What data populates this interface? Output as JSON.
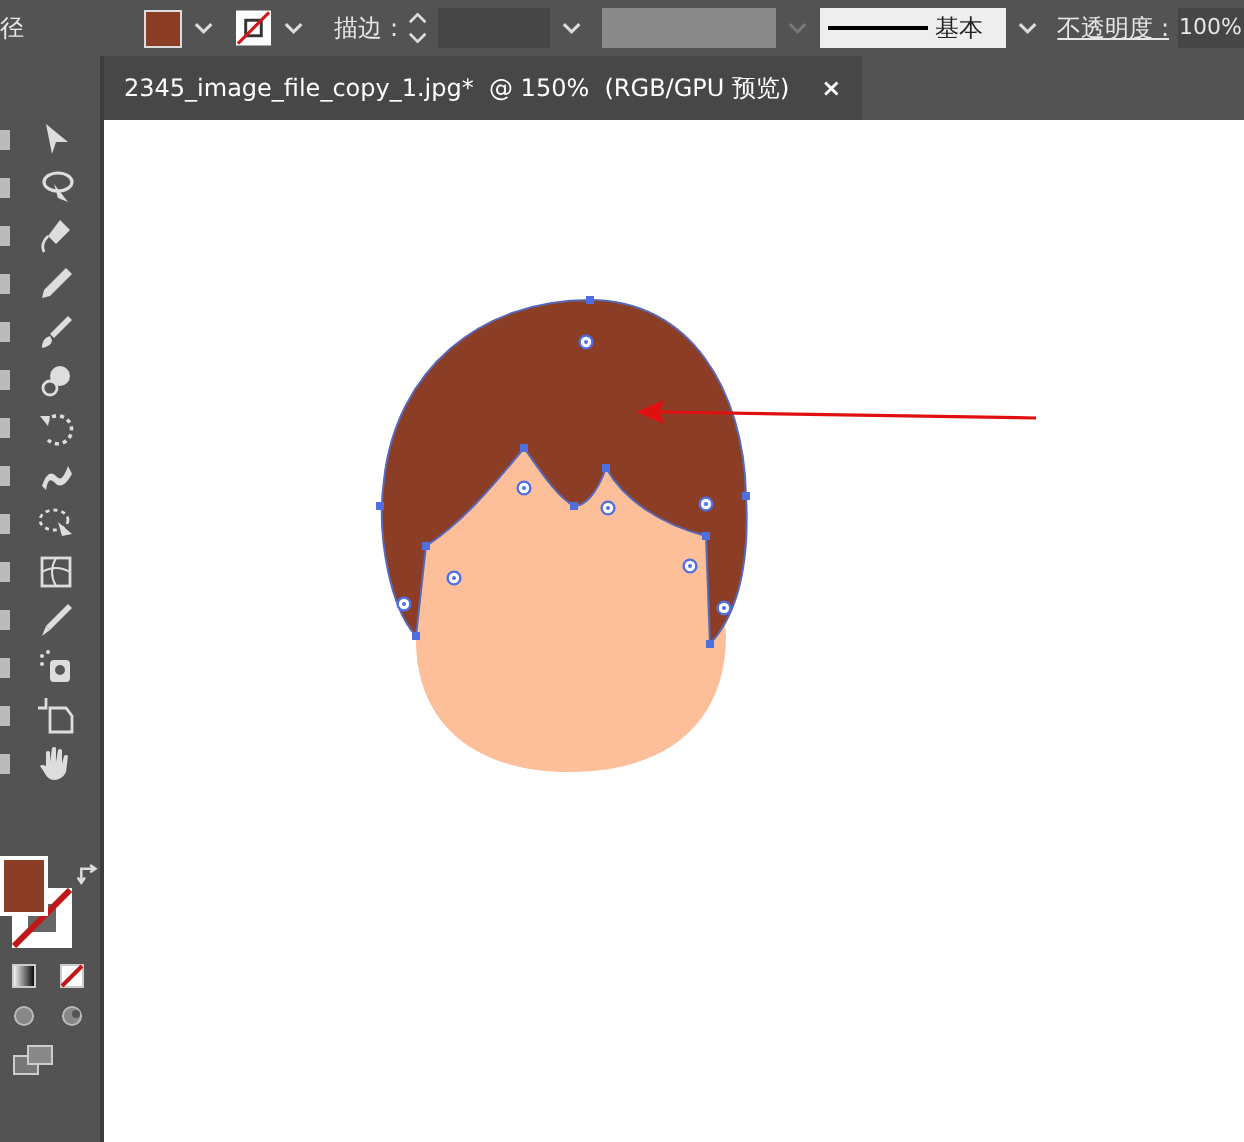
{
  "control_bar": {
    "path_label": "径",
    "fill": {
      "color": "#8b3e25"
    },
    "stroke_label": "描边 :",
    "brush_label": "基本",
    "opacity_label": "不透明度 :",
    "opacity_value": "100%"
  },
  "document_tab": {
    "title": "2345_image_file_copy_1.jpg*  @ 150%  (RGB/GPU 预览)",
    "close": "×",
    "selected": true
  }
}
